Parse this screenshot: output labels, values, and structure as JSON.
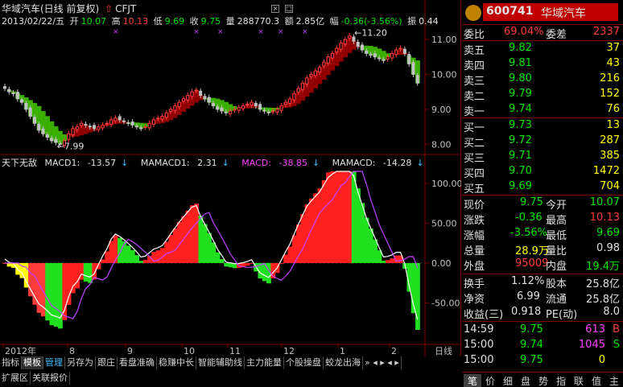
{
  "stock": {
    "name_period": "华域汽车(日线 前复权)",
    "code_tag": "CFJT",
    "date": "2013/02/22/五",
    "open_label": "开",
    "open": "10.07",
    "high_label": "高",
    "high": "10.13",
    "low_label": "低",
    "low": "9.69",
    "close_label": "收",
    "close": "9.75",
    "volume_label": "量",
    "volume": "288770.3",
    "amount_label": "额",
    "amount": "2.85亿",
    "change_label": "幅",
    "change": "-0.36(-3.56%)",
    "amplitude_label": "振",
    "amplitude": "0.44"
  },
  "price_axis": [
    "11.00",
    "10.00",
    "9.00",
    "8.00"
  ],
  "price_annotations": {
    "high": "11.20",
    "low": "7.99"
  },
  "macd": {
    "indicator_name": "天下无敌",
    "macd1_label": "MACD1:",
    "macd1": "-13.57",
    "mamacd1_label": "MAMACD1:",
    "mamacd1": "2.31",
    "macd_label": "MACD:",
    "macd": "-38.85",
    "mamacd_label": "MAMACD:",
    "mamacd": "-14.28",
    "axis": [
      "100.00",
      "50.00",
      "0.00",
      "-50.00"
    ]
  },
  "time_axis": {
    "labels": [
      "2012年",
      "8",
      "9",
      "10",
      "11",
      "12",
      "1",
      "2"
    ],
    "period": "日线"
  },
  "tabs_row1": [
    "指标",
    "模板",
    "管理",
    "另存为",
    "跟庄",
    "看盘准确",
    "稳赚中长",
    "智能辅助线",
    "主力能量",
    "个股操盘",
    "蛟龙出海"
  ],
  "tabs_row2": [
    "扩展区",
    "关联报价"
  ],
  "right_panel": {
    "code": "600741",
    "name": "华域汽车",
    "weibi_label": "委比",
    "weibi": "69.04%",
    "weicha_label": "委差",
    "weicha": "2337",
    "sell": [
      {
        "label": "卖五",
        "price": "9.82",
        "vol": "37"
      },
      {
        "label": "卖四",
        "price": "9.81",
        "vol": "43"
      },
      {
        "label": "卖三",
        "price": "9.80",
        "vol": "216"
      },
      {
        "label": "卖二",
        "price": "9.79",
        "vol": "152"
      },
      {
        "label": "卖一",
        "price": "9.74",
        "vol": "76"
      }
    ],
    "buy": [
      {
        "label": "买一",
        "price": "9.73",
        "vol": "13"
      },
      {
        "label": "买二",
        "price": "9.72",
        "vol": "287"
      },
      {
        "label": "买三",
        "price": "9.71",
        "vol": "385"
      },
      {
        "label": "买四",
        "price": "9.70",
        "vol": "1472"
      },
      {
        "label": "买五",
        "price": "9.69",
        "vol": "704"
      }
    ],
    "stats": [
      {
        "l1": "现价",
        "v1": "9.75",
        "c1": "green",
        "l2": "今开",
        "v2": "10.07",
        "c2": "green"
      },
      {
        "l1": "涨跌",
        "v1": "-0.36",
        "c1": "green",
        "l2": "最高",
        "v2": "10.13",
        "c2": "red"
      },
      {
        "l1": "涨幅",
        "v1": "-3.56%",
        "c1": "green",
        "l2": "最低",
        "v2": "9.69",
        "c2": "green"
      },
      {
        "l1": "总量",
        "v1": "28.9万",
        "c1": "yellow",
        "l2": "量比",
        "v2": "0.98",
        "c2": "white"
      },
      {
        "l1": "外盘",
        "v1": "95009",
        "c1": "red",
        "l2": "内盘",
        "v2": "19.4万",
        "c2": "green"
      }
    ],
    "stats2": [
      {
        "l1": "换手",
        "v1": "1.12%",
        "l2": "股本",
        "v2": "25.8亿"
      },
      {
        "l1": "净资",
        "v1": "6.99",
        "l2": "流通",
        "v2": "25.8亿"
      },
      {
        "l1": "收益(三)",
        "v1": "0.918",
        "l2": "PE(动)",
        "v2": "8.0"
      }
    ],
    "ticks": [
      {
        "time": "14:59",
        "price": "9.75",
        "vol": "613",
        "flag": "B",
        "vcolor": "magenta",
        "fcolor": "red"
      },
      {
        "time": "15:00",
        "price": "9.74",
        "vol": "1045",
        "flag": "S",
        "vcolor": "magenta",
        "fcolor": "green"
      },
      {
        "time": "15:00",
        "price": "9.75",
        "vol": "0",
        "flag": "",
        "vcolor": "yellow",
        "fcolor": "white"
      }
    ],
    "bottom_tabs": [
      "笔",
      "价",
      "细",
      "盘",
      "势",
      "指",
      "联",
      "值",
      "主"
    ]
  },
  "colors": {
    "up": "#ff3c3c",
    "down": "#00e600",
    "border": "#800000",
    "bg": "#000000"
  },
  "chart_data": [
    {
      "type": "candlestick",
      "title": "华域汽车(日线 前复权)",
      "ylim": [
        7.8,
        11.3
      ],
      "y_ticks": [
        8.0,
        9.0,
        10.0,
        11.0
      ],
      "x_labels": [
        "2012年",
        "8",
        "9",
        "10",
        "11",
        "12",
        "1",
        "2"
      ],
      "annotations": [
        {
          "label": "11.20",
          "value": 11.2
        },
        {
          "label": "7.99",
          "value": 7.99
        }
      ],
      "close": [
        9.6,
        9.5,
        9.45,
        9.3,
        9.2,
        9.0,
        8.8,
        8.6,
        8.4,
        8.3,
        8.2,
        8.1,
        8.05,
        8.0,
        8.1,
        8.3,
        8.45,
        8.5,
        8.6,
        8.55,
        8.5,
        8.45,
        8.5,
        8.55,
        8.6,
        8.7,
        8.75,
        8.7,
        8.65,
        8.6,
        8.55,
        8.5,
        8.45,
        8.5,
        8.6,
        8.7,
        8.75,
        8.8,
        8.9,
        9.0,
        9.1,
        9.2,
        9.3,
        9.4,
        9.5,
        9.55,
        9.4,
        9.3,
        9.2,
        9.1,
        9.0,
        8.95,
        8.9,
        8.95,
        9.0,
        9.05,
        9.1,
        9.15,
        9.2,
        9.1,
        9.0,
        8.95,
        8.9,
        8.95,
        9.0,
        9.1,
        9.2,
        9.3,
        9.45,
        9.6,
        9.75,
        9.9,
        10.0,
        10.1,
        10.2,
        10.35,
        10.5,
        10.6,
        10.75,
        10.9,
        11.0,
        11.1,
        10.95,
        10.8,
        10.7,
        10.6,
        10.55,
        10.5,
        10.45,
        10.4,
        10.5,
        10.6,
        10.7,
        10.75,
        10.6,
        10.3,
        10.0,
        9.75
      ],
      "macd_hist_note": "color-coded histogram with MACD/signal lines",
      "macd_ylim": [
        -100,
        120
      ],
      "macd_y_ticks": [
        100,
        50,
        0,
        -50
      ]
    }
  ]
}
